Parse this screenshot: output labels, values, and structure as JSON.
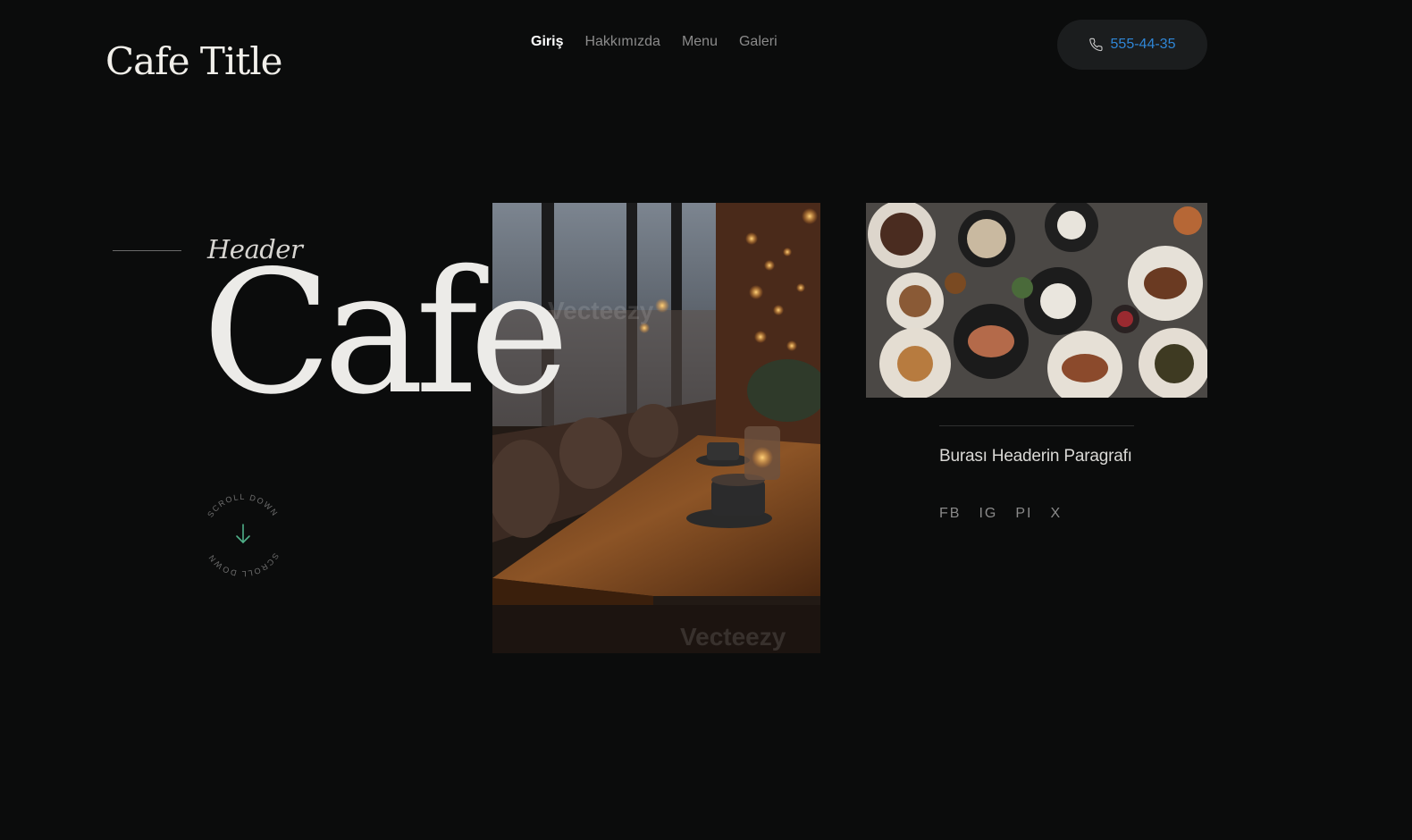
{
  "brand": {
    "title": "Cafe Title"
  },
  "nav": {
    "items": [
      {
        "label": "Giriş",
        "active": true
      },
      {
        "label": "Hakkımızda",
        "active": false
      },
      {
        "label": "Menu",
        "active": false
      },
      {
        "label": "Galeri",
        "active": false
      }
    ]
  },
  "contact": {
    "phone": "555-44-35",
    "icon": "phone-icon",
    "accent": "#2f86d6"
  },
  "hero": {
    "eyebrow": "Header",
    "headline": "Cafe",
    "scroll_text": "SCROLL DOWN",
    "scroll_icon": "arrow-down-icon",
    "scroll_accent": "#4fb089"
  },
  "aside": {
    "paragraph": "Burası Headerin Paragrafı",
    "social": [
      "FB",
      "IG",
      "PI",
      "X"
    ]
  },
  "images": {
    "main_watermark": "Vecteezy"
  },
  "theme": {
    "background": "#0b0c0c",
    "text": "#e8e6e2",
    "muted": "#8b8b8b"
  }
}
